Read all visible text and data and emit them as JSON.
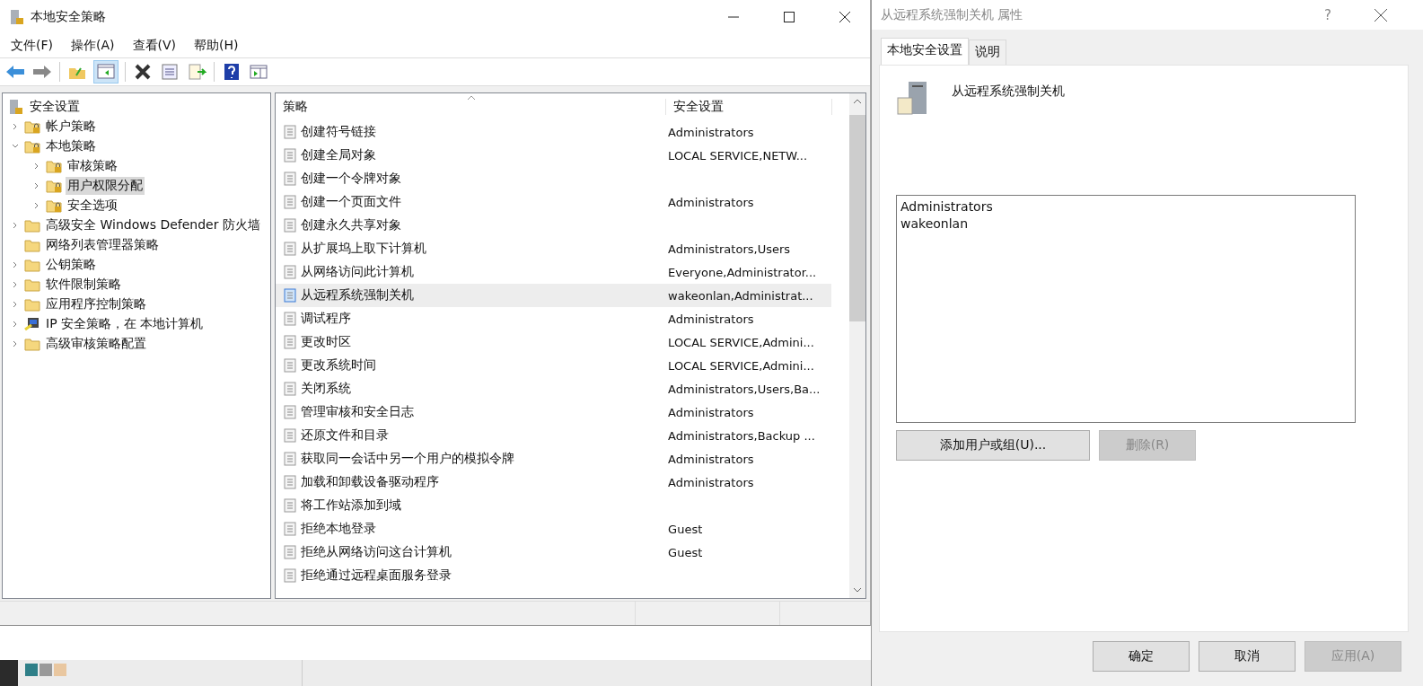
{
  "main_window": {
    "title": "本地安全策略",
    "menu": [
      "文件(F)",
      "操作(A)",
      "查看(V)",
      "帮助(H)"
    ],
    "tree": {
      "label": "安全设置",
      "kind": "server",
      "children": [
        {
          "label": "帐户策略",
          "kind": "lock-folder",
          "expandable": true,
          "expanded": false,
          "selected": false
        },
        {
          "label": "本地策略",
          "kind": "lock-folder",
          "expandable": true,
          "expanded": true,
          "selected": false,
          "children": [
            {
              "label": "审核策略",
              "kind": "lock-folder",
              "expandable": true,
              "expanded": false,
              "selected": false
            },
            {
              "label": "用户权限分配",
              "kind": "lock-folder",
              "expandable": true,
              "expanded": false,
              "selected": true
            },
            {
              "label": "安全选项",
              "kind": "lock-folder",
              "expandable": true,
              "expanded": false,
              "selected": false
            }
          ]
        },
        {
          "label": "高级安全 Windows Defender 防火墙",
          "kind": "folder",
          "expandable": true,
          "expanded": false,
          "selected": false
        },
        {
          "label": "网络列表管理器策略",
          "kind": "folder",
          "expandable": false,
          "selected": false
        },
        {
          "label": "公钥策略",
          "kind": "folder",
          "expandable": true,
          "expanded": false,
          "selected": false
        },
        {
          "label": "软件限制策略",
          "kind": "folder",
          "expandable": true,
          "expanded": false,
          "selected": false
        },
        {
          "label": "应用程序控制策略",
          "kind": "folder",
          "expandable": true,
          "expanded": false,
          "selected": false
        },
        {
          "label": "IP 安全策略，在 本地计算机",
          "kind": "ip",
          "expandable": true,
          "expanded": false,
          "selected": false
        },
        {
          "label": "高级审核策略配置",
          "kind": "folder",
          "expandable": true,
          "expanded": false,
          "selected": false
        }
      ]
    },
    "columns": [
      "策略",
      "安全设置"
    ],
    "rows": [
      {
        "policy": "创建符号链接",
        "setting": "Administrators",
        "selected": false
      },
      {
        "policy": "创建全局对象",
        "setting": "LOCAL SERVICE,NETW...",
        "selected": false
      },
      {
        "policy": "创建一个令牌对象",
        "selected": false
      },
      {
        "policy": "创建一个页面文件",
        "setting": "Administrators",
        "selected": false
      },
      {
        "policy": "创建永久共享对象",
        "selected": false
      },
      {
        "policy": "从扩展坞上取下计算机",
        "setting": "Administrators,Users",
        "selected": false
      },
      {
        "policy": "从网络访问此计算机",
        "setting": "Everyone,Administrator...",
        "selected": false
      },
      {
        "policy": "从远程系统强制关机",
        "setting": "wakeonlan,Administrat...",
        "selected": true
      },
      {
        "policy": "调试程序",
        "setting": "Administrators",
        "selected": false
      },
      {
        "policy": "更改时区",
        "setting": "LOCAL SERVICE,Admini...",
        "selected": false
      },
      {
        "policy": "更改系统时间",
        "setting": "LOCAL SERVICE,Admini...",
        "selected": false
      },
      {
        "policy": "关闭系统",
        "setting": "Administrators,Users,Ba...",
        "selected": false
      },
      {
        "policy": "管理审核和安全日志",
        "setting": "Administrators",
        "selected": false
      },
      {
        "policy": "还原文件和目录",
        "setting": "Administrators,Backup ...",
        "selected": false
      },
      {
        "policy": "获取同一会话中另一个用户的模拟令牌",
        "setting": "Administrators",
        "selected": false
      },
      {
        "policy": "加载和卸载设备驱动程序",
        "setting": "Administrators",
        "selected": false
      },
      {
        "policy": "将工作站添加到域",
        "selected": false
      },
      {
        "policy": "拒绝本地登录",
        "setting": "Guest",
        "selected": false
      },
      {
        "policy": "拒绝从网络访问这台计算机",
        "setting": "Guest",
        "selected": false
      },
      {
        "policy": "拒绝通过远程桌面服务登录",
        "selected": false
      }
    ]
  },
  "dialog": {
    "title": "从远程系统强制关机 属性",
    "help": "?",
    "tabs": [
      {
        "label": "本地安全设置",
        "selected": true
      },
      {
        "label": "说明",
        "selected": false
      }
    ],
    "policy_name": "从远程系统强制关机",
    "members": [
      "Administrators",
      "wakeonlan"
    ],
    "member_buttons": [
      {
        "label": "添加用户或组(U)...",
        "disabled": false
      },
      {
        "label": "删除(R)",
        "disabled": true
      }
    ],
    "footer_buttons": [
      {
        "label": "确定",
        "disabled": false
      },
      {
        "label": "取消",
        "disabled": false
      },
      {
        "label": "应用(A)",
        "disabled": true
      }
    ]
  }
}
